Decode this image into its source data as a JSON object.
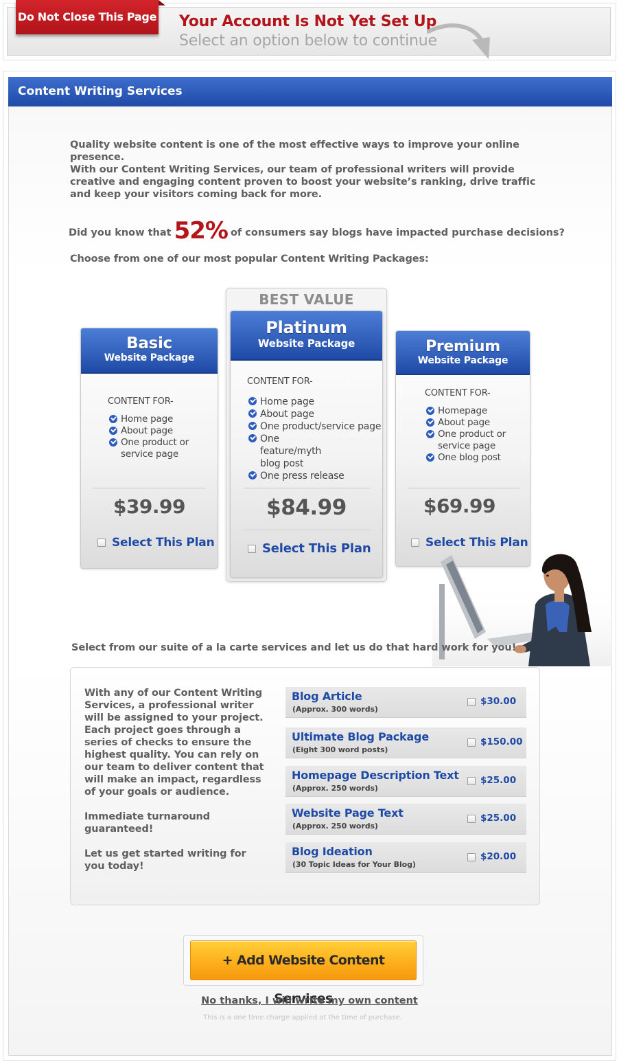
{
  "banner": {
    "close_tab": "Do Not Close This Page",
    "title": "Your Account Is Not Yet Set Up",
    "subtitle": "Select an option below to continue"
  },
  "panel": {
    "header": "Content Writing Services",
    "intro_1": "Quality website content is one of the most effective ways to improve your online presence.",
    "intro_2": "With our Content Writing Services, our team of professional writers will provide creative and engaging content proven to boost your website’s ranking, drive traffic and keep your visitors coming back for more.",
    "stat_prefix": "Did you know that",
    "stat_value": "52%",
    "stat_suffix": "of consumers say blogs have impacted purchase decisions?",
    "choose_text": "Choose from one of our most popular Content Writing Packages:"
  },
  "plans": {
    "best_value_label": "BEST VALUE",
    "basic": {
      "name": "Basic",
      "subtitle": "Website Package",
      "content_for": "CONTENT FOR-",
      "features": [
        "Home page",
        "About page",
        "One product or service page"
      ],
      "price": "$39.99",
      "select_label": "Select This Plan"
    },
    "platinum": {
      "name": "Platinum",
      "subtitle": "Website Package",
      "content_for": "CONTENT FOR-",
      "features": [
        "Home page",
        "About page",
        "One product/service page",
        "One feature/myth blog post",
        "One press release"
      ],
      "price": "$84.99",
      "select_label": "Select This Plan"
    },
    "premium": {
      "name": "Premium",
      "subtitle": "Website Package",
      "content_for": "CONTENT FOR-",
      "features": [
        "Homepage",
        "About page",
        "One product or service page",
        "One blog post"
      ],
      "price": "$69.99",
      "select_label": "Select This Plan"
    }
  },
  "alacarte": {
    "title": "Select from our suite of a la carte services and let us do that hard work for you!",
    "desc_1": "With any of our Content Writing Services, a professional writer will be assigned to your project. Each project goes through a series of checks to ensure the highest quality. You can rely on our team to deliver content that will make an impact, regardless of your goals or audience.",
    "desc_2": "Immediate turnaround guaranteed!",
    "desc_3": "Let us get started writing for you today!",
    "services": [
      {
        "name": "Blog Article",
        "note": "(Approx. 300 words)",
        "price": "$30.00"
      },
      {
        "name": "Ultimate Blog Package",
        "note": "(Eight 300 word posts)",
        "price": "$150.00"
      },
      {
        "name": "Homepage Description Text",
        "note": "(Approx. 250 words)",
        "price": "$25.00"
      },
      {
        "name": "Website Page Text",
        "note": "(Approx. 250 words)",
        "price": "$25.00"
      },
      {
        "name": "Blog Ideation",
        "note": "(30 Topic Ideas for Your Blog)",
        "price": "$20.00"
      }
    ]
  },
  "cta": {
    "add_button": "+ Add Website Content Services",
    "no_thanks": "No thanks, I will write my own content",
    "fine_print": "This is a one time charge applied at the time of purchase."
  },
  "colors": {
    "brand_blue": "#1f4aa6",
    "alert_red": "#b3151a",
    "cta_orange": "#ffb11f"
  },
  "icons": [
    "check-circle-icon",
    "checkbox-icon",
    "curved-arrow-icon"
  ]
}
